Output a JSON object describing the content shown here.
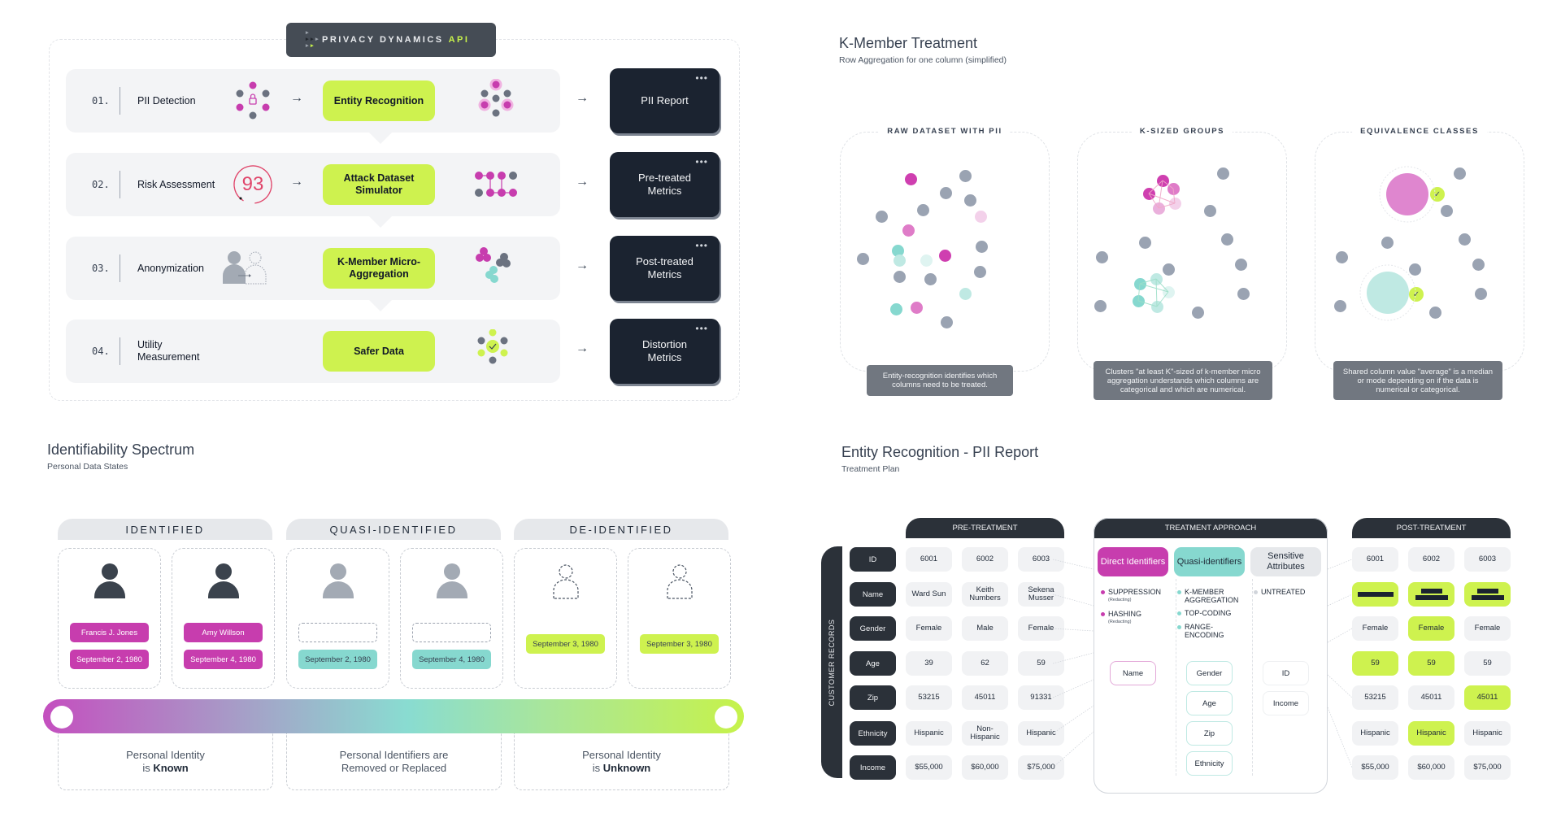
{
  "colors": {
    "lime": "#cef24f",
    "magenta": "#c73dae",
    "teal": "#86d8cf",
    "dark": "#1b2330",
    "slate": "#9aa3b2"
  },
  "pipeline": {
    "badge": {
      "prefix": "PRIVACY DYNAMICS",
      "accent": "API"
    },
    "steps": [
      {
        "num": "01.",
        "label": "PII Detection",
        "stage_icon": "lock-network-icon",
        "tool": "Entity Recognition",
        "tool_icon": "highlighted-nodes-icon",
        "output": "PII Report"
      },
      {
        "num": "02.",
        "label": "Risk Assessment",
        "stage_icon": "risk-score-gauge",
        "risk_score": "93",
        "tool": "Attack Dataset Simulator",
        "tool_icon": "linked-nodes-icon",
        "output": "Pre-treated Metrics"
      },
      {
        "num": "03.",
        "label": "Anonymization",
        "stage_icon": "person-to-anonymous-icon",
        "tool": "K-Member Micro-Aggregation",
        "tool_icon": "clustered-nodes-icon",
        "output": "Post-treated Metrics"
      },
      {
        "num": "04.",
        "label": "Utility Measurement",
        "stage_icon": "",
        "tool": "Safer Data",
        "tool_icon": "verified-nodes-icon",
        "output": "Distortion Metrics"
      }
    ],
    "output_menu_glyph": "•••",
    "arrow_glyph": "→"
  },
  "kmember": {
    "title": "K-Member Treatment",
    "subtitle": "Row Aggregation for one column (simplified)",
    "panels": [
      {
        "title": "RAW DATASET WITH PII",
        "caption": "Entity-recognition identifies which columns need to be treated."
      },
      {
        "title": "K-SIZED GROUPS",
        "caption": "Clusters \"at least K\"-sized of k-member micro aggregation understands which columns are categorical and which are numerical."
      },
      {
        "title": "EQUIVALENCE CLASSES",
        "caption": "Shared column value \"average\" is a median or mode depending on if the data is numerical or categorical."
      }
    ]
  },
  "spectrum": {
    "title": "Identifiability Spectrum",
    "subtitle": "Personal Data States",
    "categories": [
      {
        "label": "IDENTIFIED",
        "desc_line1": "Personal Identity",
        "desc_pre": "is ",
        "desc_bold": "Known"
      },
      {
        "label": "QUASI-IDENTIFIED",
        "desc_line1": "Personal Identifiers are",
        "desc_pre": "Removed or Replaced",
        "desc_bold": ""
      },
      {
        "label": "DE-IDENTIFIED",
        "desc_line1": "Personal Identity",
        "desc_pre": "is ",
        "desc_bold": "Unknown"
      }
    ],
    "cards": [
      {
        "state": "identified",
        "name": "Francis J. Jones",
        "date": "September 2, 1980"
      },
      {
        "state": "identified",
        "name": "Amy Willson",
        "date": "September 4, 1980"
      },
      {
        "state": "quasi",
        "name": "",
        "date": "September 2, 1980"
      },
      {
        "state": "quasi",
        "name": "",
        "date": "September 4, 1980"
      },
      {
        "state": "deidentified",
        "name": "",
        "date": "September 3, 1980"
      },
      {
        "state": "deidentified",
        "name": "",
        "date": "September 3, 1980"
      }
    ]
  },
  "pii_report": {
    "title": "Entity Recognition - PII Report",
    "subtitle": "Treatment Plan",
    "side_label": "CUSTOMER RECORDS",
    "pre_header": "PRE-TREATMENT",
    "approach_header": "TREATMENT APPROACH",
    "post_header": "POST-TREATMENT",
    "fields": [
      "ID",
      "Name",
      "Gender",
      "Age",
      "Zip",
      "Ethnicity",
      "Income"
    ],
    "pre_rows": [
      [
        "6001",
        "6002",
        "6003"
      ],
      [
        "Ward Sun",
        "Keith Numbers",
        "Sekena Musser"
      ],
      [
        "Female",
        "Male",
        "Female"
      ],
      [
        "39",
        "62",
        "59"
      ],
      [
        "53215",
        "45011",
        "91331"
      ],
      [
        "Hispanic",
        "Non-Hispanic",
        "Hispanic"
      ],
      [
        "$55,000",
        "$60,000",
        "$75,000"
      ]
    ],
    "post_rows": [
      [
        {
          "v": "6001",
          "hl": false
        },
        {
          "v": "6002",
          "hl": false
        },
        {
          "v": "6003",
          "hl": false
        }
      ],
      [
        {
          "v": "",
          "hl": true,
          "redacted": 1
        },
        {
          "v": "",
          "hl": true,
          "redacted": 2
        },
        {
          "v": "",
          "hl": true,
          "redacted": 2
        }
      ],
      [
        {
          "v": "Female",
          "hl": false
        },
        {
          "v": "Female",
          "hl": true
        },
        {
          "v": "Female",
          "hl": false
        }
      ],
      [
        {
          "v": "59",
          "hl": true
        },
        {
          "v": "59",
          "hl": true
        },
        {
          "v": "59",
          "hl": false
        }
      ],
      [
        {
          "v": "53215",
          "hl": false
        },
        {
          "v": "45011",
          "hl": false
        },
        {
          "v": "45011",
          "hl": true
        }
      ],
      [
        {
          "v": "Hispanic",
          "hl": false
        },
        {
          "v": "Hispanic",
          "hl": true
        },
        {
          "v": "Hispanic",
          "hl": false
        }
      ],
      [
        {
          "v": "$55,000",
          "hl": false
        },
        {
          "v": "$60,000",
          "hl": false
        },
        {
          "v": "$75,000",
          "hl": false
        }
      ]
    ],
    "approach": [
      {
        "heading": "Direct Identifiers",
        "methods": [
          {
            "name": "SUPPRESSION",
            "note": "(Redacting)"
          },
          {
            "name": "HASHING",
            "note": "(Redacting)"
          }
        ],
        "fields": [
          "Name"
        ]
      },
      {
        "heading": "Quasi-identifiers",
        "methods": [
          {
            "name": "K-MEMBER AGGREGATION",
            "note": ""
          },
          {
            "name": "TOP-CODING",
            "note": ""
          },
          {
            "name": "RANGE-ENCODING",
            "note": ""
          }
        ],
        "fields": [
          "Gender",
          "Age",
          "Zip",
          "Ethnicity"
        ]
      },
      {
        "heading": "Sensitive Attributes",
        "methods": [
          {
            "name": "UNTREATED",
            "note": ""
          }
        ],
        "fields": [
          "ID",
          "Income"
        ]
      }
    ]
  }
}
